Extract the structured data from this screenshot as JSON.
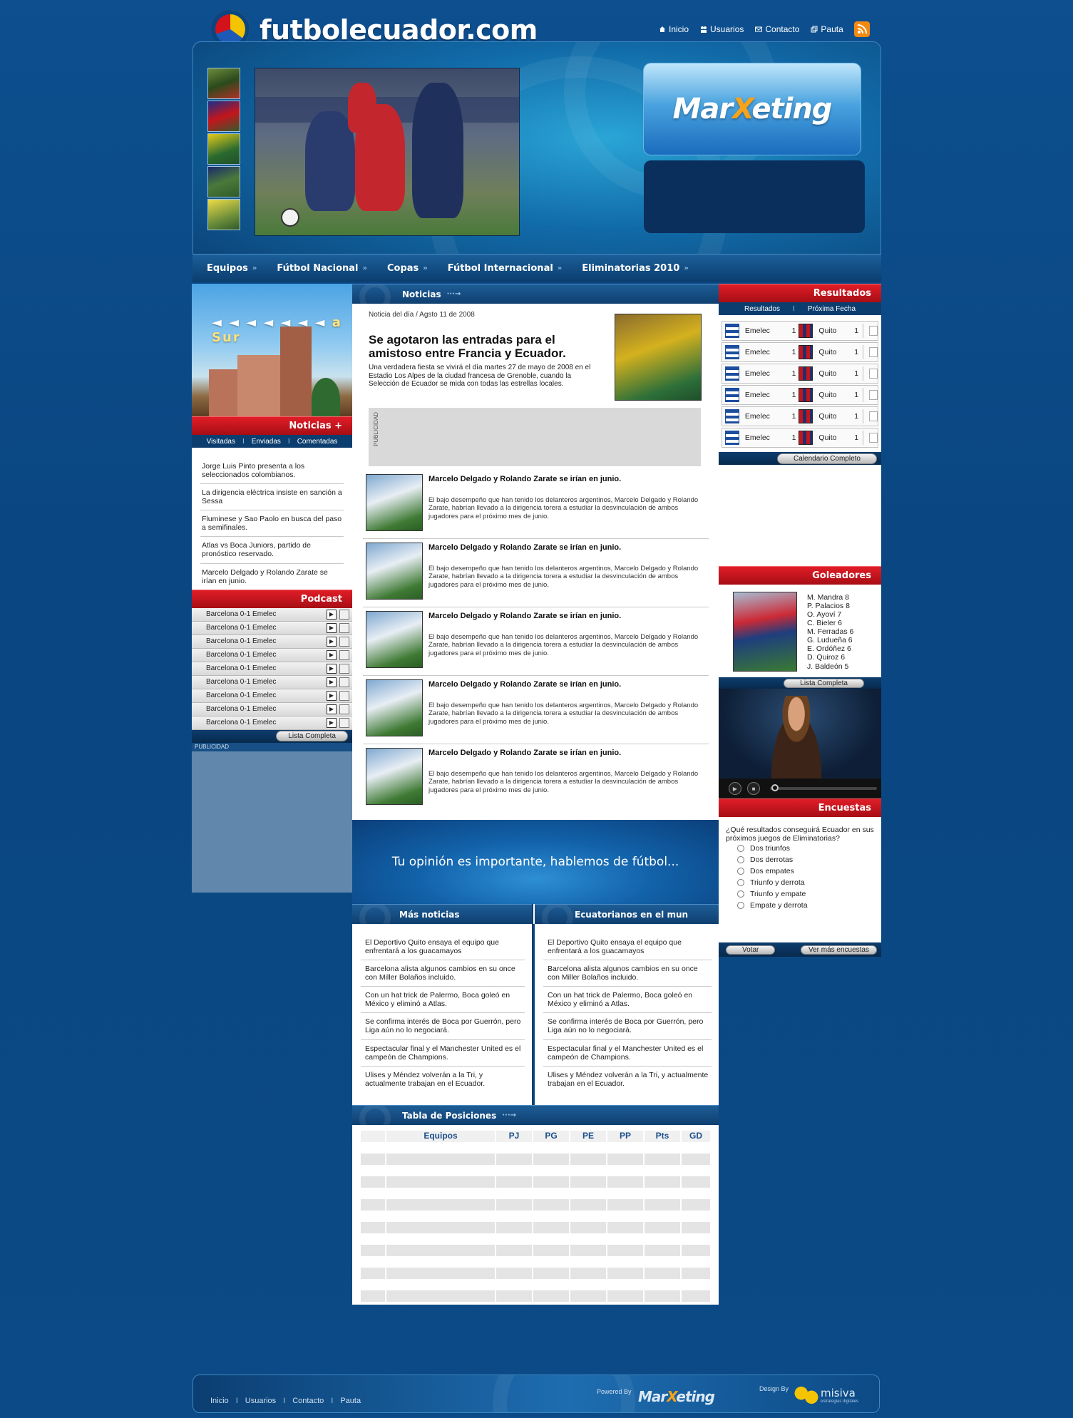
{
  "site": {
    "name": "futbolecuador.com"
  },
  "topnav": [
    {
      "label": "Inicio",
      "icon": "home-icon"
    },
    {
      "label": "Usuarios",
      "icon": "users-icon"
    },
    {
      "label": "Contacto",
      "icon": "mail-icon"
    },
    {
      "label": "Pauta",
      "icon": "pages-icon"
    }
  ],
  "rss": {
    "icon": "rss-icon",
    "color": "#f28a12"
  },
  "sponsor": {
    "name": "Mar",
    "x": "X",
    "rest": "eting"
  },
  "mainnav": [
    "Equipos",
    "Fútbol Nacional",
    "Copas",
    "Fútbol Internacional",
    "Eliminatorias 2010"
  ],
  "promo": {
    "arrows": "◄ ◄ ◄ ◄ ◄ ◄ ◄",
    "text": "a Sur"
  },
  "left": {
    "noticias_title": "Noticias  +",
    "tabs": [
      "Visitadas",
      "Enviadas",
      "Comentadas"
    ],
    "noticias": [
      "Jorge Luis Pinto presenta a los seleccionados colombianos.",
      "La dirigencia eléctrica insiste en sanción a Sessa",
      "Fluminese y Sao Paolo en busca del paso a semifinales.",
      "Atlas vs Boca Juniors, partido de pronóstico reservado.",
      "Marcelo Delgado y Rolando Zarate se irían en junio."
    ],
    "podcast_title": "Podcast",
    "podcasts": [
      "Barcelona 0-1 Emelec",
      "Barcelona 0-1 Emelec",
      "Barcelona 0-1 Emelec",
      "Barcelona 0-1 Emelec",
      "Barcelona 0-1 Emelec",
      "Barcelona 0-1 Emelec",
      "Barcelona 0-1 Emelec",
      "Barcelona 0-1 Emelec",
      "Barcelona 0-1 Emelec"
    ],
    "lista_completa": "Lista Completa",
    "publicidad": "PUBLICIDAD"
  },
  "center": {
    "noticias_header": "Noticias",
    "main_news": {
      "date": "Noticia del día / Agsto 11 de 2008",
      "title": "Se agotaron las entradas para el amistoso entre Francia y Ecuador.",
      "body": "Una verdadera fiesta se vivirá el día martes 27 de mayo de 2008 en el Estadio Los Alpes de la ciudad francesa de Grenoble, cuando la Selección de Ecuador se mida con todas las estrellas locales."
    },
    "publicidad": "PUBLICIDAD",
    "news_items": [
      {
        "title": "Marcelo Delgado y Rolando Zarate se irían en junio.",
        "body": "El bajo desempeño que han tenido los delanteros argentinos, Marcelo Delgado y Rolando Zarate, habrían llevado a la dirigencia torera a estudiar la desvinculación de ambos jugadores para el próximo mes de junio."
      },
      {
        "title": "Marcelo Delgado y Rolando Zarate se irían en junio.",
        "body": "El bajo desempeño que han tenido los delanteros argentinos, Marcelo Delgado y Rolando Zarate, habrían llevado a la dirigencia torera a estudiar la desvinculación de ambos jugadores para el próximo mes de junio."
      },
      {
        "title": "Marcelo Delgado y Rolando Zarate se irían en junio.",
        "body": "El bajo desempeño que han tenido los delanteros argentinos, Marcelo Delgado y Rolando Zarate, habrían llevado a la dirigencia torera a estudiar la desvinculación de ambos jugadores para el próximo mes de junio."
      },
      {
        "title": "Marcelo Delgado y Rolando Zarate se irían en junio.",
        "body": "El bajo desempeño que han tenido los delanteros argentinos, Marcelo Delgado y Rolando Zarate, habrían llevado a la dirigencia torera a estudiar la desvinculación de ambos jugadores para el próximo mes de junio."
      },
      {
        "title": "Marcelo Delgado y Rolando Zarate se irían en junio.",
        "body": "El bajo desempeño que han tenido los delanteros argentinos, Marcelo Delgado y Rolando Zarate, habrían llevado a la dirigencia torera a estudiar la desvinculación de ambos jugadores para el próximo mes de junio."
      }
    ],
    "opinion": "Tu opinión es importante, hablemos de fútbol...",
    "mas_noticias": {
      "title": "Más noticias",
      "items": [
        "El Deportivo Quito ensaya el equipo que enfrentará a los guacamayos",
        "Barcelona alista algunos cambios en su once con Miller Bolaños incluido.",
        "Con un hat trick de Palermo, Boca goleó en México y eliminó a Atlas.",
        "Se confirma interés de Boca por Guerrón, pero Liga aún no lo negociará.",
        "Espectacular final y el Manchester United es el campeón de Champions.",
        "Ulises y Méndez volverán a la Tri, y actualmente trabajan en el Ecuador."
      ]
    },
    "ecuatorianos": {
      "title": "Ecuatorianos en el mun",
      "items": [
        "El Deportivo Quito ensaya el equipo que enfrentará a los guacamayos",
        "Barcelona alista algunos cambios en su once con Miller Bolaños incluido.",
        "Con un hat trick de Palermo, Boca goleó en México y eliminó a Atlas.",
        "Se confirma interés de Boca por Guerrón, pero Liga aún no lo negociará.",
        "Espectacular final y el Manchester United es el campeón de Champions.",
        "Ulises y Méndez volverán a la Tri, y actualmente trabajan en el Ecuador."
      ]
    },
    "tabla": {
      "title": "Tabla de Posiciones",
      "columns": [
        "Equipos",
        "PJ",
        "PG",
        "PE",
        "PP",
        "Pts",
        "GD"
      ]
    }
  },
  "right": {
    "resultados_title": "Resultados",
    "tabs": [
      "Resultados",
      "Próxima Fecha"
    ],
    "resultados": [
      {
        "home": "Emelec",
        "hs": "1",
        "away": "Quito",
        "as": "1"
      },
      {
        "home": "Emelec",
        "hs": "1",
        "away": "Quito",
        "as": "1"
      },
      {
        "home": "Emelec",
        "hs": "1",
        "away": "Quito",
        "as": "1"
      },
      {
        "home": "Emelec",
        "hs": "1",
        "away": "Quito",
        "as": "1"
      },
      {
        "home": "Emelec",
        "hs": "1",
        "away": "Quito",
        "as": "1"
      },
      {
        "home": "Emelec",
        "hs": "1",
        "away": "Quito",
        "as": "1"
      }
    ],
    "calendario": "Calendario Completo",
    "goleadores_title": "Goleadores",
    "goleadores": [
      "M. Mandra 8",
      "P. Palacios 8",
      "O. Ayoví 7",
      "C. Bieler 6",
      "M. Ferradas 6",
      "G. Ludueña 6",
      "E. Ordóñez 6",
      "D. Quiroz 6",
      "J. Baldeón 5"
    ],
    "lista_completa": "Lista Completa",
    "encuestas_title": "Encuestas",
    "encuesta_q": "¿Qué resultados conseguirá Ecuador en sus próximos juegos de Eliminatorias?",
    "opciones": [
      "Dos triunfos",
      "Dos derrotas",
      "Dos empates",
      "Triunfo y derrota",
      "Triunfo y empate",
      "Empate y derrota"
    ],
    "votar": "Votar",
    "ver_mas": "Ver más encuestas"
  },
  "footer": {
    "nav": [
      "Inicio",
      "Usuarios",
      "Contacto",
      "Pauta"
    ],
    "powered": "Powered By",
    "design": "Design By",
    "misiva": "misiva",
    "misiva_sub": "estrategias digitales"
  }
}
